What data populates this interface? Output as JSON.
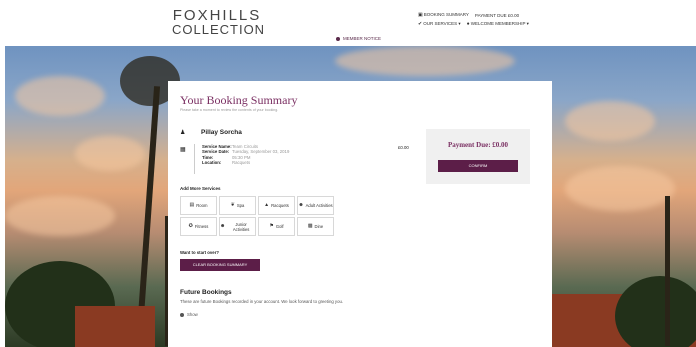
{
  "logo": {
    "line1": "FOXHILLS",
    "line2": "COLLECTION"
  },
  "member_notice": "MEMBER NOTICE",
  "topnav": {
    "booking_summary": "BOOKING SUMMARY",
    "payment_due": "PAYMENT DUE £0.00",
    "our_services": "OUR SERVICES",
    "welcome": "WELCOME MEMBERSHIP"
  },
  "summary": {
    "title": "Your Booking Summary",
    "subtitle": "Please take a moment to review the contents of your booking.",
    "person_name": "Pillay Sorcha",
    "details": [
      {
        "label": "Service Name:",
        "value": "Team Circuits"
      },
      {
        "label": "Service Date:",
        "value": "Tuesday, September 03, 2019"
      },
      {
        "label": "Time:",
        "value": "05:30 PM"
      },
      {
        "label": "Location:",
        "value": "Racquets"
      }
    ],
    "price": "£0.00"
  },
  "payment": {
    "due_text": "Payment Due: £0.00",
    "confirm_label": "CONFIRM"
  },
  "add_more": {
    "heading": "Add More Services",
    "services": [
      {
        "label": "Room",
        "icon": "bed-icon"
      },
      {
        "label": "Spa",
        "icon": "leaf-icon"
      },
      {
        "label": "Racquets",
        "icon": "racquet-icon"
      },
      {
        "label": "Adult Activities",
        "icon": "group-icon"
      },
      {
        "label": "Fitness",
        "icon": "dumbbell-icon"
      },
      {
        "label": "Junior Activities",
        "icon": "child-icon"
      },
      {
        "label": "Golf",
        "icon": "flag-icon"
      },
      {
        "label": "Dine",
        "icon": "dine-icon"
      }
    ]
  },
  "start_over": {
    "question": "Want to start over?",
    "button": "CLEAR BOOKING SUMMARY"
  },
  "future": {
    "title": "Future Bookings",
    "description": "These are future Bookings recorded in your account. We look forward to greeting you.",
    "show_label": "Show"
  },
  "colors": {
    "brand": "#5c1e48",
    "title": "#7a2f62"
  }
}
